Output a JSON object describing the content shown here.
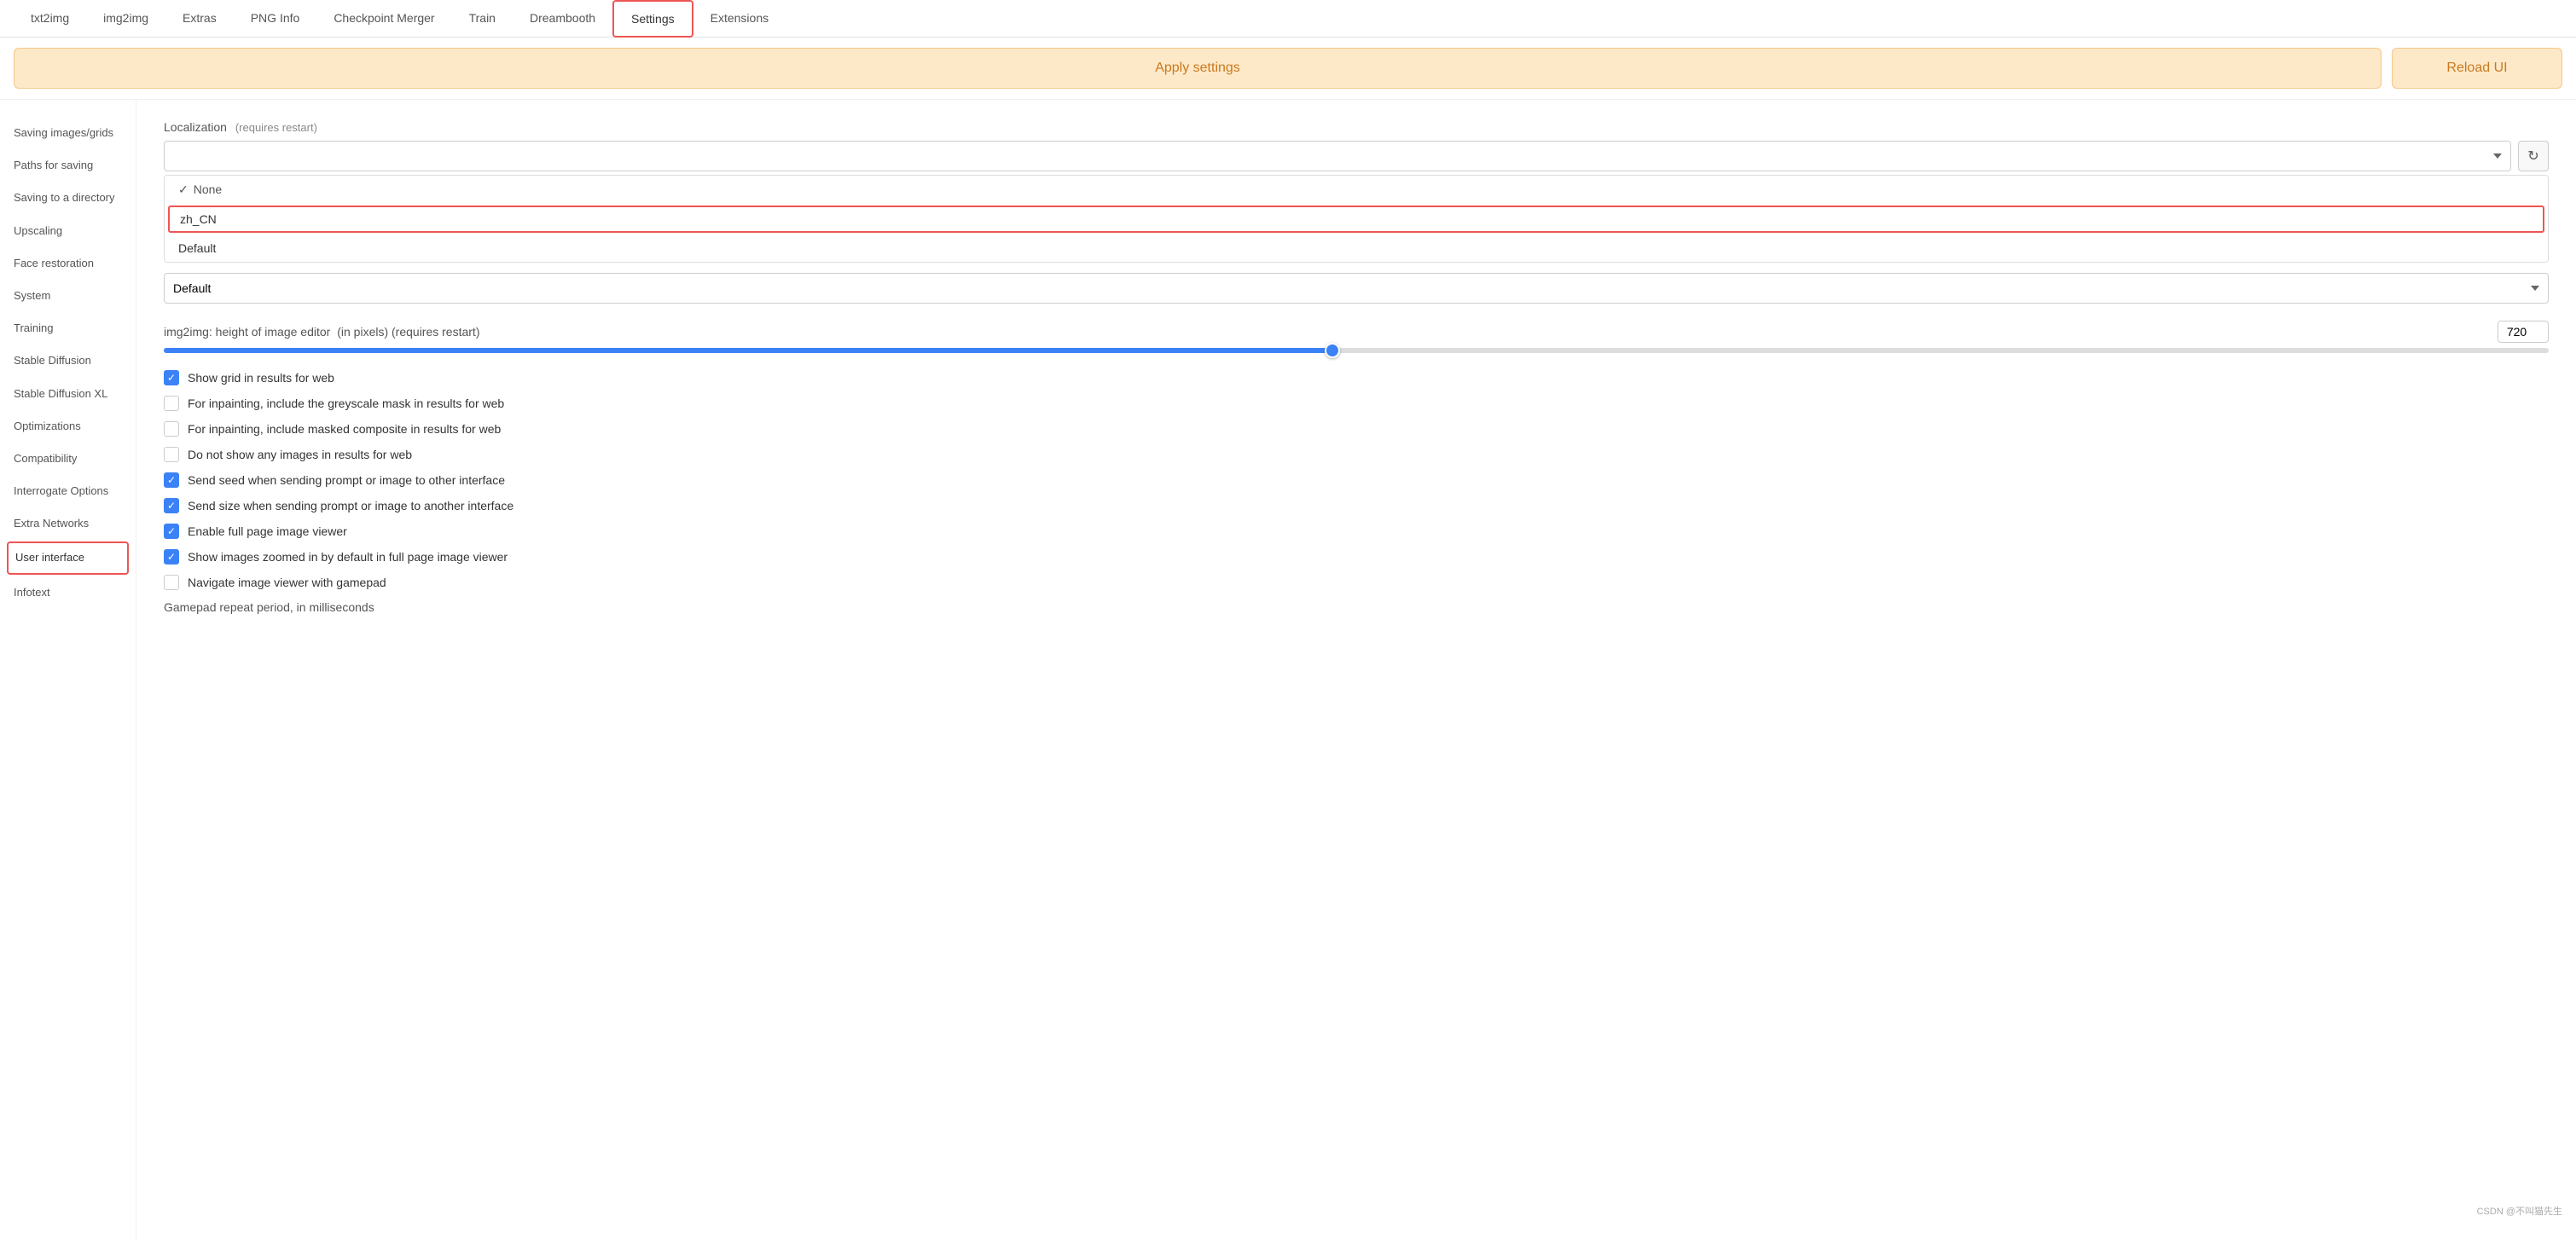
{
  "nav": {
    "tabs": [
      {
        "id": "txt2img",
        "label": "txt2img",
        "active": false
      },
      {
        "id": "img2img",
        "label": "img2img",
        "active": false
      },
      {
        "id": "extras",
        "label": "Extras",
        "active": false
      },
      {
        "id": "png-info",
        "label": "PNG Info",
        "active": false
      },
      {
        "id": "checkpoint-merger",
        "label": "Checkpoint Merger",
        "active": false
      },
      {
        "id": "train",
        "label": "Train",
        "active": false
      },
      {
        "id": "dreambooth",
        "label": "Dreambooth",
        "active": false
      },
      {
        "id": "settings",
        "label": "Settings",
        "active": true
      },
      {
        "id": "extensions",
        "label": "Extensions",
        "active": false
      }
    ]
  },
  "actions": {
    "apply_settings": "Apply settings",
    "reload_ui": "Reload UI"
  },
  "sidebar": {
    "items": [
      {
        "id": "saving-images",
        "label": "Saving images/grids",
        "active": false
      },
      {
        "id": "paths-for-saving",
        "label": "Paths for saving",
        "active": false
      },
      {
        "id": "saving-to-directory",
        "label": "Saving to a directory",
        "active": false
      },
      {
        "id": "upscaling",
        "label": "Upscaling",
        "active": false
      },
      {
        "id": "face-restoration",
        "label": "Face restoration",
        "active": false
      },
      {
        "id": "system",
        "label": "System",
        "active": false
      },
      {
        "id": "training",
        "label": "Training",
        "active": false
      },
      {
        "id": "stable-diffusion",
        "label": "Stable Diffusion",
        "active": false
      },
      {
        "id": "stable-diffusion-xl",
        "label": "Stable Diffusion XL",
        "active": false
      },
      {
        "id": "optimizations",
        "label": "Optimizations",
        "active": false
      },
      {
        "id": "compatibility",
        "label": "Compatibility",
        "active": false
      },
      {
        "id": "interrogate-options",
        "label": "Interrogate Options",
        "active": false
      },
      {
        "id": "extra-networks",
        "label": "Extra Networks",
        "active": false
      },
      {
        "id": "user-interface",
        "label": "User interface",
        "active": true
      },
      {
        "id": "infotext",
        "label": "Infotext",
        "active": false
      }
    ]
  },
  "content": {
    "localization": {
      "label": "Localization",
      "note": "(requires restart)",
      "options": [
        "None",
        "zh_CN",
        "Default"
      ],
      "selected": "",
      "highlighted": "zh_CN"
    },
    "default_dropdown": {
      "value": "Default"
    },
    "img2img_height": {
      "label": "img2img: height of image editor",
      "note": "(in pixels) (requires restart)",
      "value": 720,
      "min": 0,
      "max": 2048,
      "fill_percent": 49
    },
    "checkboxes": [
      {
        "id": "show-grid-web",
        "label": "Show grid in results for web",
        "checked": true
      },
      {
        "id": "inpainting-greyscale",
        "label": "For inpainting, include the greyscale mask in results for web",
        "checked": false
      },
      {
        "id": "inpainting-composite",
        "label": "For inpainting, include masked composite in results for web",
        "checked": false
      },
      {
        "id": "no-images-web",
        "label": "Do not show any images in results for web",
        "checked": false
      },
      {
        "id": "send-seed",
        "label": "Send seed when sending prompt or image to other interface",
        "checked": true
      },
      {
        "id": "send-size",
        "label": "Send size when sending prompt or image to another interface",
        "checked": true
      },
      {
        "id": "full-page-viewer",
        "label": "Enable full page image viewer",
        "checked": true
      },
      {
        "id": "zoomed-default",
        "label": "Show images zoomed in by default in full page image viewer",
        "checked": true
      },
      {
        "id": "gamepad-nav",
        "label": "Navigate image viewer with gamepad",
        "checked": false
      }
    ],
    "gamepad_label": "Gamepad repeat period, in milliseconds"
  },
  "watermark": "CSDN @不叫猫先生"
}
